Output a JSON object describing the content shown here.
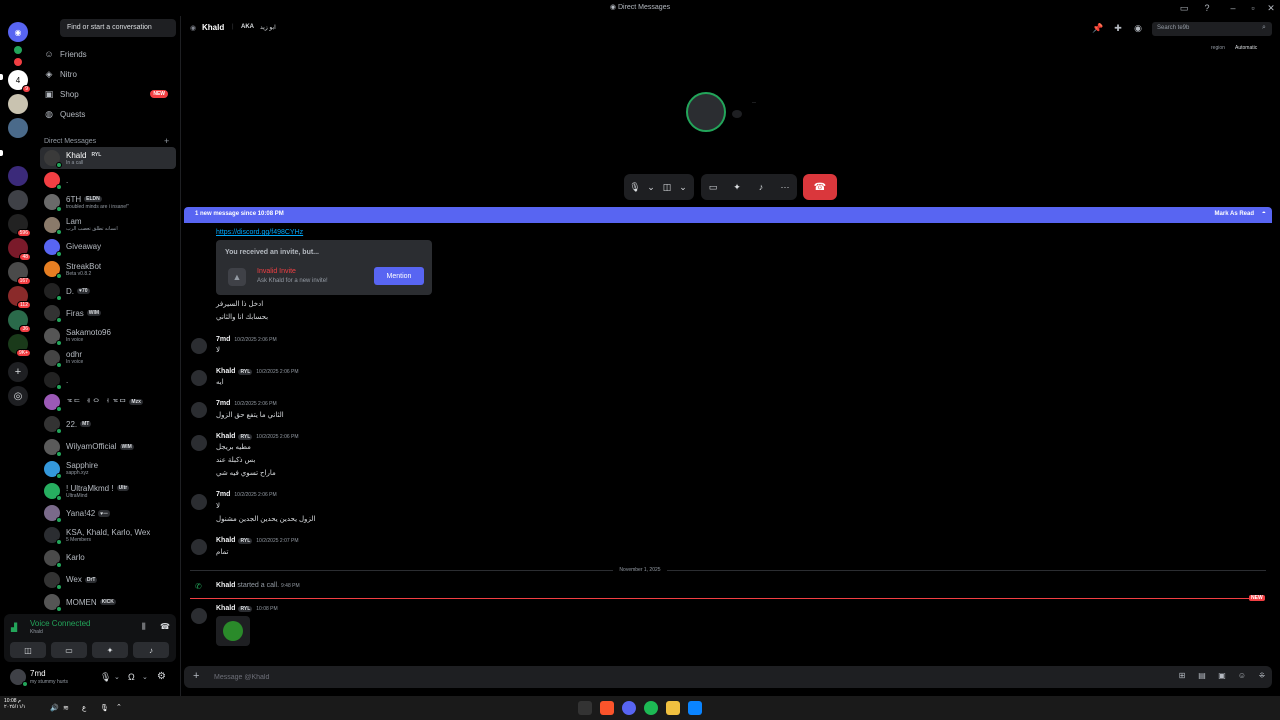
{
  "window": {
    "title": "Direct Messages"
  },
  "overlay": {
    "logo": "K",
    "number": "5"
  },
  "search": {
    "placeholder": "Find or start a conversation"
  },
  "nav": [
    {
      "label": "Friends",
      "icon": "friends-icon"
    },
    {
      "label": "Nitro",
      "icon": "nitro-icon"
    },
    {
      "label": "Shop",
      "icon": "shop-icon",
      "badge": "NEW"
    },
    {
      "label": "Quests",
      "icon": "quests-icon"
    }
  ],
  "dm_header": "Direct Messages",
  "servers": [
    {
      "badge": "1"
    },
    {
      "badge": "9"
    },
    {
      "badge": ""
    },
    {
      "badge": ""
    },
    {
      "badge": ""
    },
    {
      "badge": ""
    },
    {
      "badge": "596"
    },
    {
      "badge": "48"
    },
    {
      "badge": "167"
    },
    {
      "badge": "112"
    },
    {
      "badge": "36"
    },
    {
      "badge": "9K+"
    }
  ],
  "dms": [
    {
      "name": "Khald",
      "tag": "RYL",
      "sub": "In a call",
      "selected": true
    },
    {
      "name": ".",
      "tag": "",
      "sub": ""
    },
    {
      "name": "6TH",
      "tag": "ELDN",
      "sub": "troubled minds are i insane!\""
    },
    {
      "name": "Lam",
      "tag": "",
      "sub": "انسانه تطلق تعصب الرب"
    },
    {
      "name": "Giveaway",
      "tag": "",
      "sub": ""
    },
    {
      "name": "StreakBot",
      "tag": "",
      "sub": "Beta v0.8.2"
    },
    {
      "name": "D.",
      "tag": "♥70",
      "sub": ""
    },
    {
      "name": "Firas",
      "tag": "WIM",
      "sub": ""
    },
    {
      "name": "Sakamoto96",
      "tag": "",
      "sub": "In voice"
    },
    {
      "name": "odhr",
      "tag": "",
      "sub": "In voice"
    },
    {
      "name": ".",
      "tag": "",
      "sub": ""
    },
    {
      "name": "ᅚᄃ ᅦ ᄋ ᅥ ᅚᄆ",
      "tag": "Mzx",
      "sub": ""
    },
    {
      "name": "22.",
      "tag": "MT",
      "sub": ""
    },
    {
      "name": "WilyamOfficial",
      "tag": "WIM",
      "sub": ""
    },
    {
      "name": "Sapphire",
      "tag": "",
      "sub": "sapph.xyz"
    },
    {
      "name": "! UltraMkmd !",
      "tag": "Ultr",
      "sub": "UltraMind"
    },
    {
      "name": "Yana!42",
      "tag": "♥ᅳ",
      "sub": ""
    },
    {
      "name": "KSA, Khald, Karlo, Wex",
      "tag": "",
      "sub": "5 Members"
    },
    {
      "name": "Karlo",
      "tag": "",
      "sub": ""
    },
    {
      "name": "Wex",
      "tag": "DrT",
      "sub": ""
    },
    {
      "name": "MOMEN",
      "tag": "KICK",
      "sub": ""
    }
  ],
  "voice": {
    "title": "Voice Connected",
    "channel": "Khald"
  },
  "user": {
    "name": "7md",
    "status": "my stummy hurts"
  },
  "header": {
    "name": "Khald",
    "aka_label": "AKA",
    "aka_value": "ابو زيد",
    "search_placeholder": "Search te9b",
    "region_label": "region",
    "region_value": "Automatic"
  },
  "new_message_bar": {
    "text": "1 new message since 10:08 PM",
    "action": "Mark As Read"
  },
  "invite": {
    "link": "https://discord.gg/f498CYHz",
    "heading": "You received an invite, but...",
    "title": "Invalid Invite",
    "subtitle": "Ask Khald for a new invite!",
    "button": "Mention"
  },
  "messages": [
    {
      "author": "",
      "time": "",
      "lines": [
        "ادخل ذا السيرفر",
        "بحسابك انا والثاني"
      ]
    },
    {
      "author": "7md",
      "tag": "",
      "time": "10/2/2025 2:06 PM",
      "lines": [
        "لا"
      ]
    },
    {
      "author": "Khald",
      "tag": "RYL",
      "time": "10/2/2025 2:06 PM",
      "lines": [
        "ايه"
      ]
    },
    {
      "author": "7md",
      "tag": "",
      "time": "10/2/2025 2:06 PM",
      "lines": [
        "الثاني ما يتفع حق الزول"
      ]
    },
    {
      "author": "Khald",
      "tag": "RYL",
      "time": "10/2/2025 2:06 PM",
      "lines": [
        "مطيه بريجل",
        "بس ذكبلة عند",
        "ماراح تسوي فيه شي"
      ]
    },
    {
      "author": "7md",
      "tag": "",
      "time": "10/2/2025 2:06 PM",
      "lines": [
        "لا",
        "الزول يحدين يحدين الجدين مشنول"
      ]
    },
    {
      "author": "Khald",
      "tag": "RYL",
      "time": "10/2/2025 2:07 PM",
      "lines": [
        "تمام"
      ]
    }
  ],
  "date_divider": "November 1, 2025",
  "call_event": {
    "author": "Khald",
    "text": "started a call.",
    "time": "9:48 PM"
  },
  "new_tag": "NEW",
  "last_message": {
    "author": "Khald",
    "tag": "RYL",
    "time": "10:08 PM"
  },
  "composer": {
    "placeholder": "Message @Khald"
  },
  "taskbar": {
    "time": "10:08 م",
    "date": "٢٠٢٥/١١/١"
  },
  "colors": {
    "accent": "#5865f2",
    "danger": "#da373c",
    "online": "#23a55a",
    "kick": "#53fc18"
  }
}
